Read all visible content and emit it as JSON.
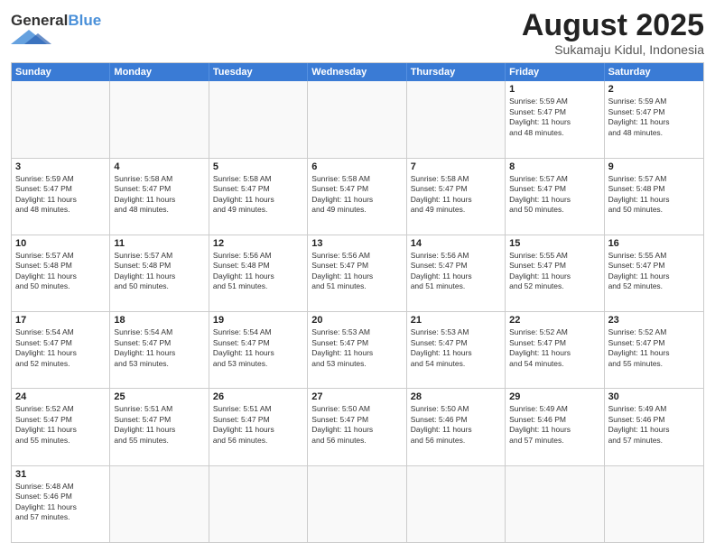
{
  "header": {
    "logo_general": "General",
    "logo_blue": "Blue",
    "month_title": "August 2025",
    "location": "Sukamaju Kidul, Indonesia"
  },
  "weekdays": [
    "Sunday",
    "Monday",
    "Tuesday",
    "Wednesday",
    "Thursday",
    "Friday",
    "Saturday"
  ],
  "rows": [
    [
      {
        "day": "",
        "info": ""
      },
      {
        "day": "",
        "info": ""
      },
      {
        "day": "",
        "info": ""
      },
      {
        "day": "",
        "info": ""
      },
      {
        "day": "",
        "info": ""
      },
      {
        "day": "1",
        "info": "Sunrise: 5:59 AM\nSunset: 5:47 PM\nDaylight: 11 hours\nand 48 minutes."
      },
      {
        "day": "2",
        "info": "Sunrise: 5:59 AM\nSunset: 5:47 PM\nDaylight: 11 hours\nand 48 minutes."
      }
    ],
    [
      {
        "day": "3",
        "info": "Sunrise: 5:59 AM\nSunset: 5:47 PM\nDaylight: 11 hours\nand 48 minutes."
      },
      {
        "day": "4",
        "info": "Sunrise: 5:58 AM\nSunset: 5:47 PM\nDaylight: 11 hours\nand 48 minutes."
      },
      {
        "day": "5",
        "info": "Sunrise: 5:58 AM\nSunset: 5:47 PM\nDaylight: 11 hours\nand 49 minutes."
      },
      {
        "day": "6",
        "info": "Sunrise: 5:58 AM\nSunset: 5:47 PM\nDaylight: 11 hours\nand 49 minutes."
      },
      {
        "day": "7",
        "info": "Sunrise: 5:58 AM\nSunset: 5:47 PM\nDaylight: 11 hours\nand 49 minutes."
      },
      {
        "day": "8",
        "info": "Sunrise: 5:57 AM\nSunset: 5:47 PM\nDaylight: 11 hours\nand 50 minutes."
      },
      {
        "day": "9",
        "info": "Sunrise: 5:57 AM\nSunset: 5:48 PM\nDaylight: 11 hours\nand 50 minutes."
      }
    ],
    [
      {
        "day": "10",
        "info": "Sunrise: 5:57 AM\nSunset: 5:48 PM\nDaylight: 11 hours\nand 50 minutes."
      },
      {
        "day": "11",
        "info": "Sunrise: 5:57 AM\nSunset: 5:48 PM\nDaylight: 11 hours\nand 50 minutes."
      },
      {
        "day": "12",
        "info": "Sunrise: 5:56 AM\nSunset: 5:48 PM\nDaylight: 11 hours\nand 51 minutes."
      },
      {
        "day": "13",
        "info": "Sunrise: 5:56 AM\nSunset: 5:47 PM\nDaylight: 11 hours\nand 51 minutes."
      },
      {
        "day": "14",
        "info": "Sunrise: 5:56 AM\nSunset: 5:47 PM\nDaylight: 11 hours\nand 51 minutes."
      },
      {
        "day": "15",
        "info": "Sunrise: 5:55 AM\nSunset: 5:47 PM\nDaylight: 11 hours\nand 52 minutes."
      },
      {
        "day": "16",
        "info": "Sunrise: 5:55 AM\nSunset: 5:47 PM\nDaylight: 11 hours\nand 52 minutes."
      }
    ],
    [
      {
        "day": "17",
        "info": "Sunrise: 5:54 AM\nSunset: 5:47 PM\nDaylight: 11 hours\nand 52 minutes."
      },
      {
        "day": "18",
        "info": "Sunrise: 5:54 AM\nSunset: 5:47 PM\nDaylight: 11 hours\nand 53 minutes."
      },
      {
        "day": "19",
        "info": "Sunrise: 5:54 AM\nSunset: 5:47 PM\nDaylight: 11 hours\nand 53 minutes."
      },
      {
        "day": "20",
        "info": "Sunrise: 5:53 AM\nSunset: 5:47 PM\nDaylight: 11 hours\nand 53 minutes."
      },
      {
        "day": "21",
        "info": "Sunrise: 5:53 AM\nSunset: 5:47 PM\nDaylight: 11 hours\nand 54 minutes."
      },
      {
        "day": "22",
        "info": "Sunrise: 5:52 AM\nSunset: 5:47 PM\nDaylight: 11 hours\nand 54 minutes."
      },
      {
        "day": "23",
        "info": "Sunrise: 5:52 AM\nSunset: 5:47 PM\nDaylight: 11 hours\nand 55 minutes."
      }
    ],
    [
      {
        "day": "24",
        "info": "Sunrise: 5:52 AM\nSunset: 5:47 PM\nDaylight: 11 hours\nand 55 minutes."
      },
      {
        "day": "25",
        "info": "Sunrise: 5:51 AM\nSunset: 5:47 PM\nDaylight: 11 hours\nand 55 minutes."
      },
      {
        "day": "26",
        "info": "Sunrise: 5:51 AM\nSunset: 5:47 PM\nDaylight: 11 hours\nand 56 minutes."
      },
      {
        "day": "27",
        "info": "Sunrise: 5:50 AM\nSunset: 5:47 PM\nDaylight: 11 hours\nand 56 minutes."
      },
      {
        "day": "28",
        "info": "Sunrise: 5:50 AM\nSunset: 5:46 PM\nDaylight: 11 hours\nand 56 minutes."
      },
      {
        "day": "29",
        "info": "Sunrise: 5:49 AM\nSunset: 5:46 PM\nDaylight: 11 hours\nand 57 minutes."
      },
      {
        "day": "30",
        "info": "Sunrise: 5:49 AM\nSunset: 5:46 PM\nDaylight: 11 hours\nand 57 minutes."
      }
    ],
    [
      {
        "day": "31",
        "info": "Sunrise: 5:48 AM\nSunset: 5:46 PM\nDaylight: 11 hours\nand 57 minutes."
      },
      {
        "day": "",
        "info": ""
      },
      {
        "day": "",
        "info": ""
      },
      {
        "day": "",
        "info": ""
      },
      {
        "day": "",
        "info": ""
      },
      {
        "day": "",
        "info": ""
      },
      {
        "day": "",
        "info": ""
      }
    ]
  ]
}
